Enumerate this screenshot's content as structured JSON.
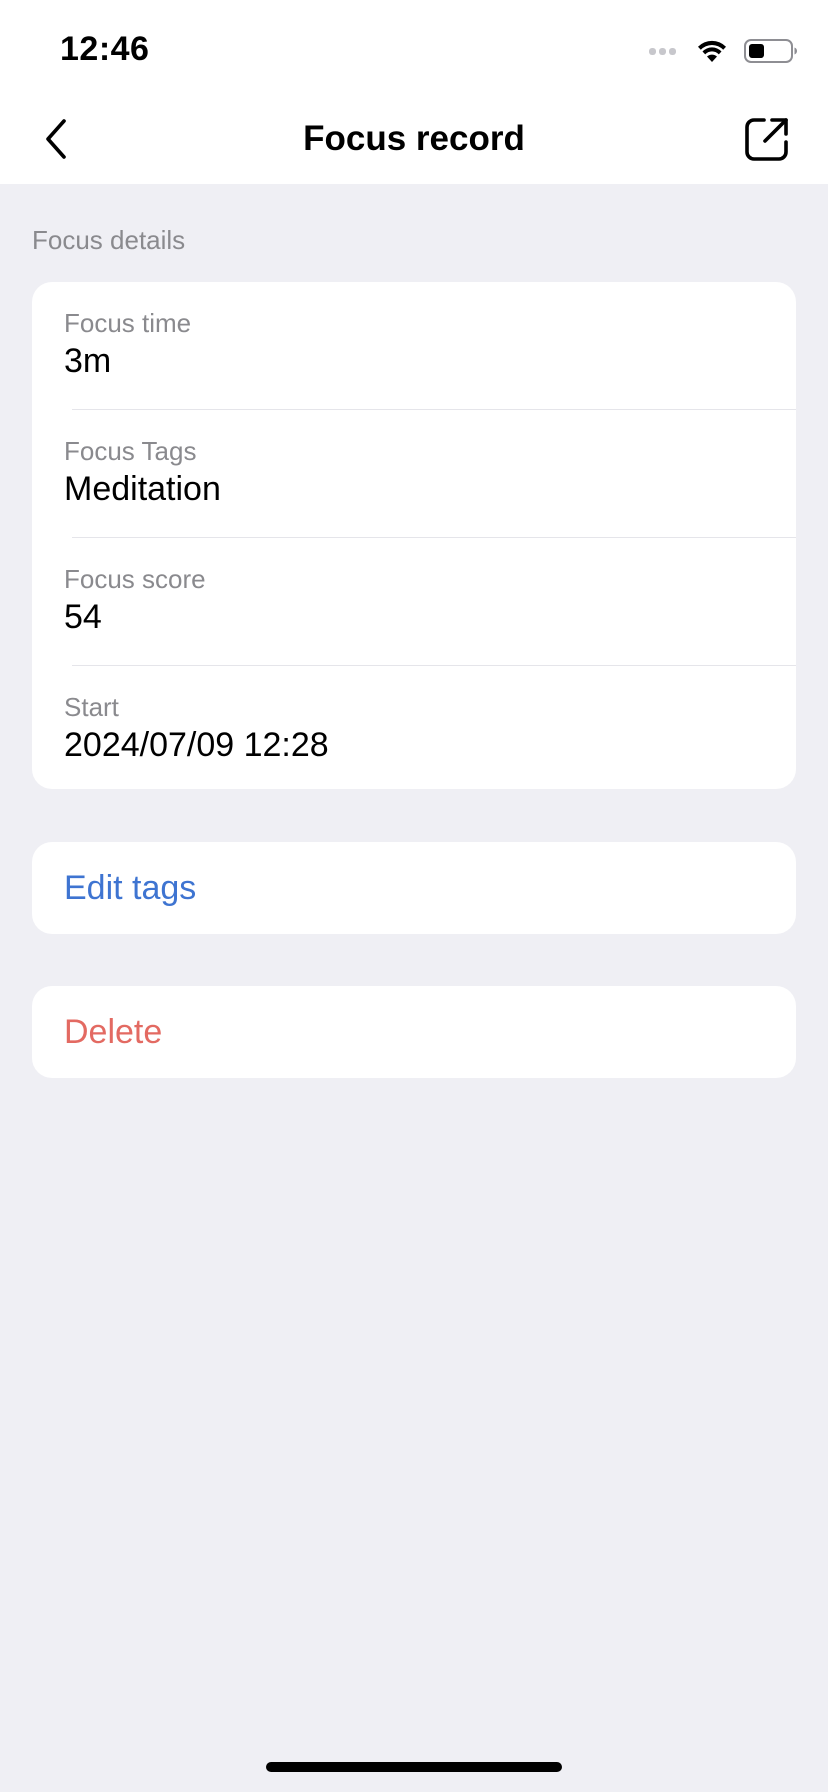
{
  "status_bar": {
    "time": "12:46",
    "icons": [
      "cellular-signal-icon",
      "wifi-icon",
      "battery-icon"
    ]
  },
  "nav": {
    "title": "Focus record",
    "back_icon": "chevron-left-icon",
    "share_icon": "share-external-icon"
  },
  "details": {
    "section_title": "Focus details",
    "rows": [
      {
        "label": "Focus time",
        "value": "3m"
      },
      {
        "label": "Focus Tags",
        "value": "Meditation"
      },
      {
        "label": "Focus score",
        "value": "54"
      },
      {
        "label": "Start",
        "value": "2024/07/09 12:28"
      }
    ]
  },
  "actions": {
    "edit_tags": "Edit tags",
    "delete": "Delete"
  },
  "colors": {
    "background": "#efeff4",
    "card": "#ffffff",
    "link_blue": "#3e74d1",
    "destructive_red": "#e36a62",
    "secondary_text": "#8a8a8e"
  }
}
